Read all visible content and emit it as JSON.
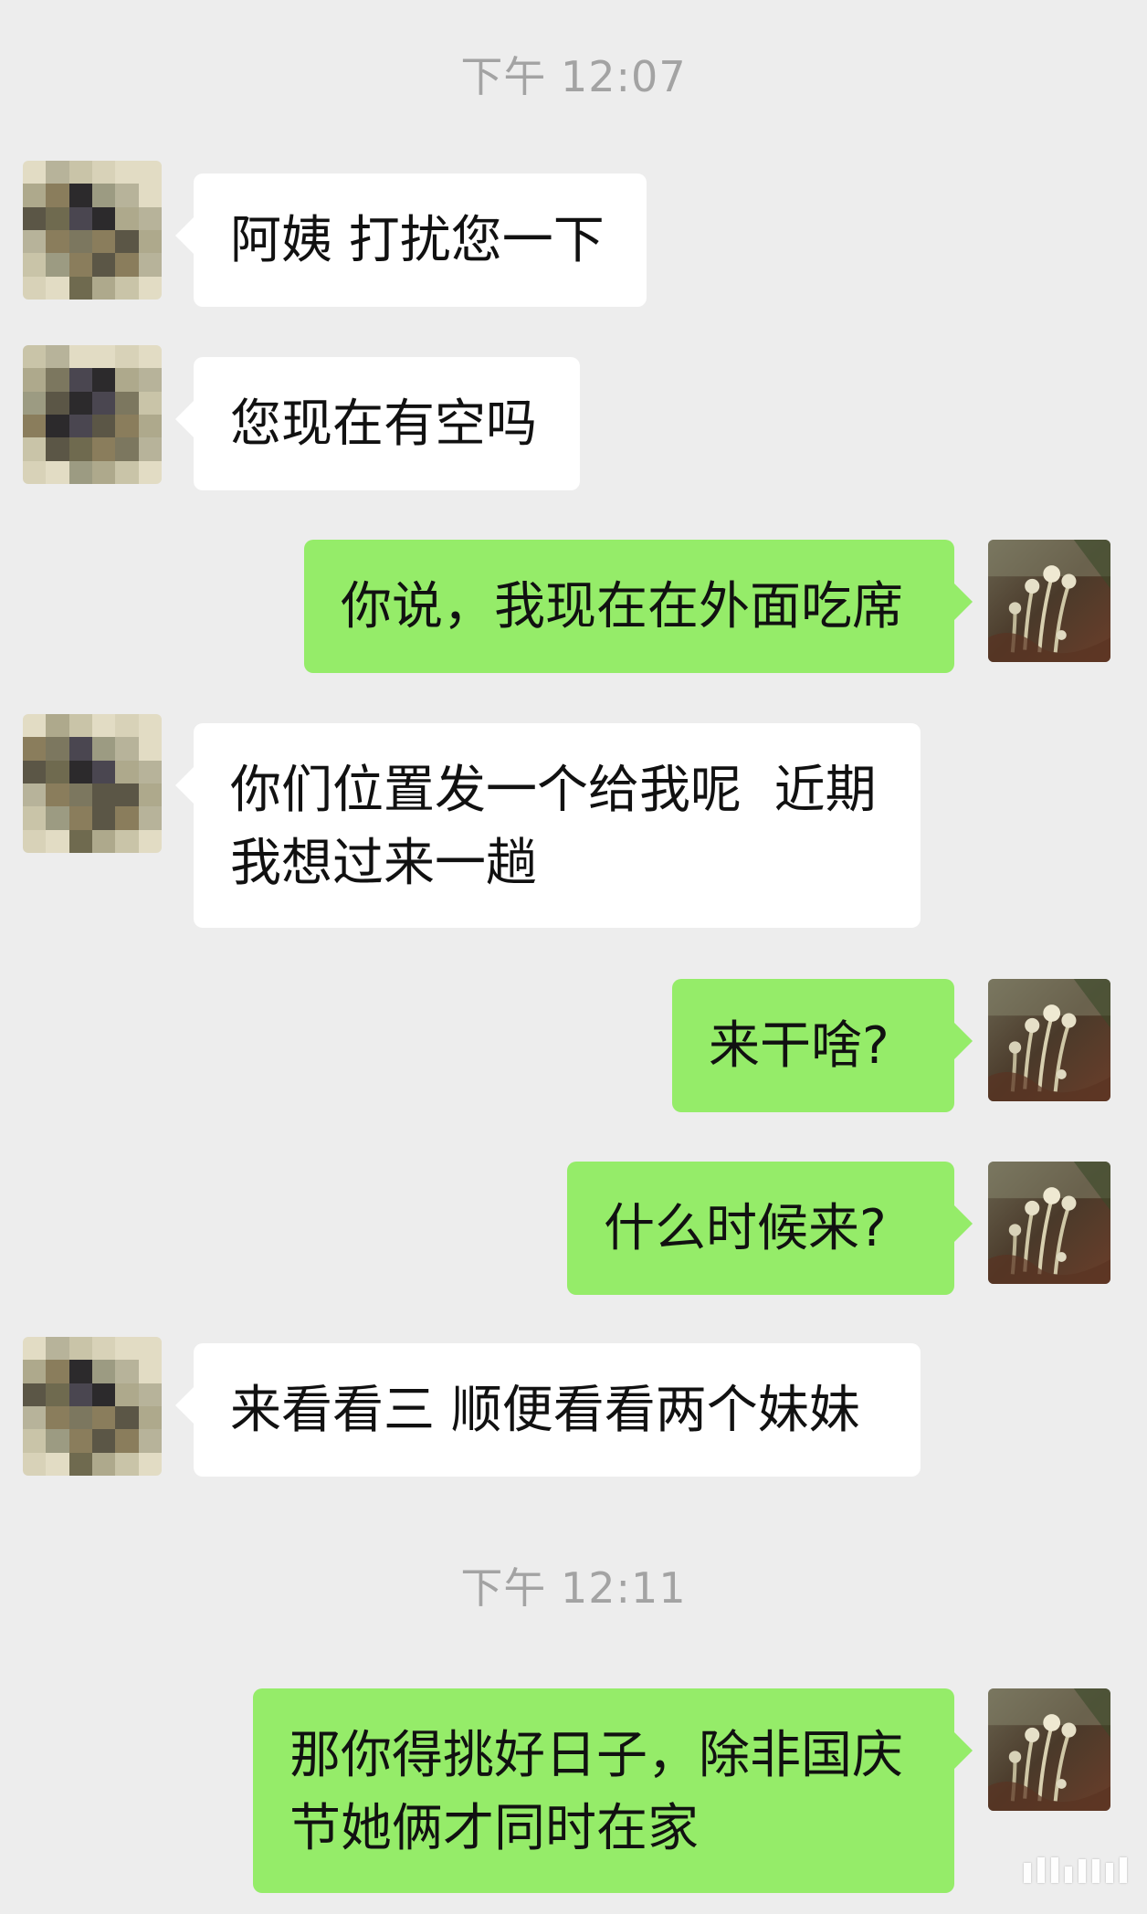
{
  "timestamps": [
    "下午 12:07",
    "下午 12:11"
  ],
  "messages": [
    {
      "side": "left",
      "text": "阿姨 打扰您一下"
    },
    {
      "side": "left",
      "text": "您现在有空吗"
    },
    {
      "side": "right",
      "text": "你说，我现在在外面吃席"
    },
    {
      "side": "left",
      "text": "你们位置发一个给我呢  近期\n我想过来一趟"
    },
    {
      "side": "right",
      "text": "来干啥?"
    },
    {
      "side": "right",
      "text": "什么时候来?"
    },
    {
      "side": "left",
      "text": "来看看三 顺便看看两个妹妹"
    },
    {
      "side": "right",
      "text": "那你得挑好日子，除非国庆\n节她俩才同时在家"
    }
  ],
  "avatars": {
    "contact": "pixelated-avatar",
    "self": "plant-photo-avatar"
  },
  "colors": {
    "background": "#ededed",
    "incoming_bubble": "#ffffff",
    "outgoing_bubble": "#95ec69",
    "timestamp": "#a3a3a3"
  }
}
